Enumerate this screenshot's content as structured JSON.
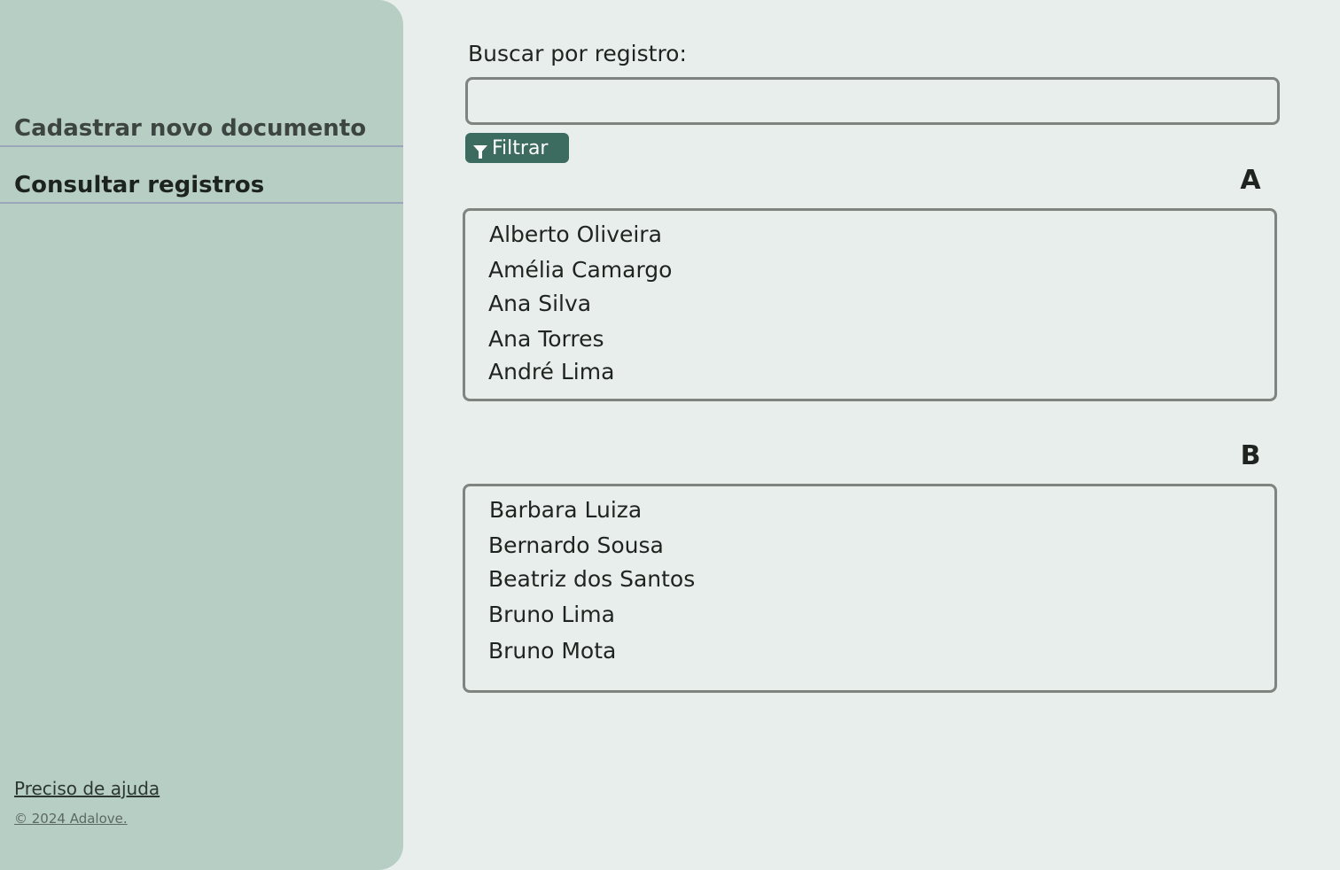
{
  "sidebar": {
    "nav_items": [
      {
        "label": "Cadastrar novo documento",
        "active": false
      },
      {
        "label": "Consultar registros",
        "active": true
      }
    ],
    "help_link": "Preciso de ajuda",
    "copyright": "© 2024 Adalove."
  },
  "search": {
    "label": "Buscar por registro:",
    "value": "",
    "placeholder": "",
    "filter_button_label": "Filtrar",
    "filter_icon": "funnel-icon"
  },
  "groups": [
    {
      "letter": "A",
      "records": [
        "Alberto Oliveira",
        "Amélia Camargo",
        "Ana Silva",
        "Ana Torres",
        "André Lima"
      ]
    },
    {
      "letter": "B",
      "records": [
        "Barbara Luiza",
        "Bernardo Sousa",
        "Beatriz dos Santos",
        "Bruno Lima",
        "Bruno Mota"
      ]
    }
  ],
  "colors": {
    "sidebar_bg": "#b7cec5",
    "page_bg": "#e8eeec",
    "accent": "#3c6b5f",
    "border": "#7f8481"
  }
}
